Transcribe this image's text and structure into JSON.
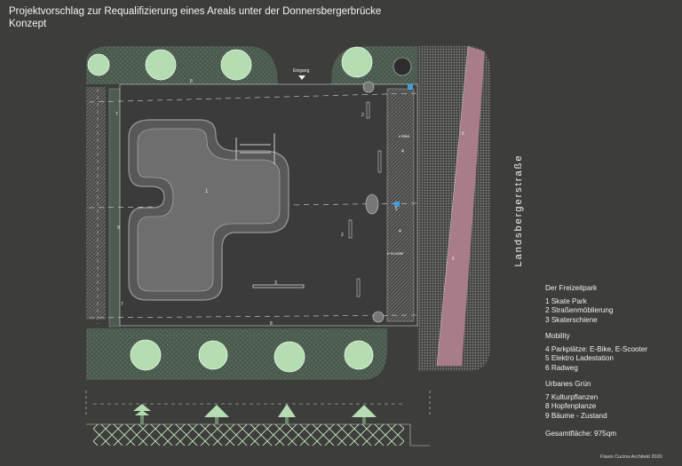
{
  "header": {
    "title": "Projektvorschlag zur Requalifizierung eines Areals unter der Donnersbergerbrücke",
    "subtitle": "Konzept"
  },
  "street_label": "Landsbergerstraße",
  "plan": {
    "entrance_label": "Eingang",
    "labels": {
      "skate_park": "1",
      "furniture_a": "2",
      "furniture_b": "2",
      "rail": "3",
      "parking_top": "4",
      "parking_bottom": "4",
      "charger": "5",
      "bikepath_top": "6",
      "bikepath_bottom": "6",
      "crop_top": "7",
      "crop_bottom": "7",
      "hop_top": "8",
      "hop_bottom": "8",
      "tree": "9",
      "ebike": "e-bike",
      "escooter": "e-scooter"
    }
  },
  "legend": {
    "sections": [
      {
        "heading": "Der Freizeitpark",
        "items": [
          "1  Skate Park",
          "2  Straßenmöblierung",
          "3  Skaterschiene"
        ]
      },
      {
        "heading": "Mobility",
        "items": [
          "4  Parkplätze: E-Bike, E-Scooter",
          "5  Elektro Ladestation",
          "6  Radweg"
        ]
      },
      {
        "heading": "Urbanes Grün",
        "items": [
          "7  Kulturpflanzen",
          "8  Hopfenplanze",
          "9  Bäume - Zustand"
        ]
      }
    ],
    "total_area": "Gesamtfläche: 975qm"
  },
  "credit": "Flavio Cucina Architekt 2020",
  "colors": {
    "background": "#3d3d3b",
    "green_area": "#4c5a4f",
    "bike_lane": "#a87c89",
    "tree_crown": "#b4ddb1",
    "plaza": "#3b3b3b"
  }
}
